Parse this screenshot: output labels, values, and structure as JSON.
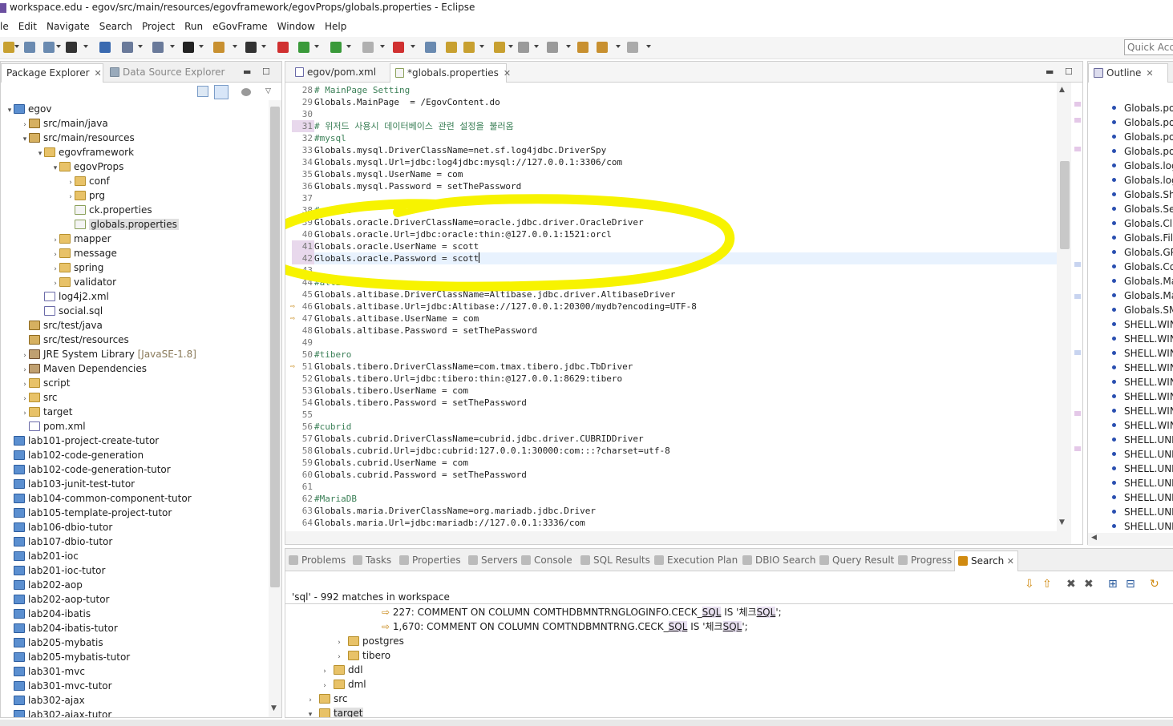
{
  "window": {
    "title": "workspace.edu - egov/src/main/resources/egovframework/egovProps/globals.properties - Eclipse"
  },
  "menu": [
    "le",
    "Edit",
    "Navigate",
    "Search",
    "Project",
    "Run",
    "eGovFrame",
    "Window",
    "Help"
  ],
  "quick_access": "Quick Acce",
  "explorer": {
    "tabs": [
      {
        "label": "Package Explorer",
        "active": true
      },
      {
        "label": "Data Source Explorer",
        "active": false
      }
    ],
    "tree": [
      {
        "depth": 0,
        "label": "egov",
        "toggle": "▾",
        "icon": "proj"
      },
      {
        "depth": 1,
        "label": "src/main/java",
        "toggle": "›",
        "icon": "src"
      },
      {
        "depth": 1,
        "label": "src/main/resources",
        "toggle": "▾",
        "icon": "src"
      },
      {
        "depth": 2,
        "label": "egovframework",
        "toggle": "▾",
        "icon": "folder"
      },
      {
        "depth": 3,
        "label": "egovProps",
        "toggle": "▾",
        "icon": "folder"
      },
      {
        "depth": 4,
        "label": "conf",
        "toggle": "›",
        "icon": "folder"
      },
      {
        "depth": 4,
        "label": "prg",
        "toggle": "›",
        "icon": "folder"
      },
      {
        "depth": 4,
        "label": "ck.properties",
        "toggle": "",
        "icon": "file"
      },
      {
        "depth": 4,
        "label": "globals.properties",
        "toggle": "",
        "icon": "file",
        "selected": true
      },
      {
        "depth": 3,
        "label": "mapper",
        "toggle": "›",
        "icon": "folder"
      },
      {
        "depth": 3,
        "label": "message",
        "toggle": "›",
        "icon": "folder"
      },
      {
        "depth": 3,
        "label": "spring",
        "toggle": "›",
        "icon": "folder"
      },
      {
        "depth": 3,
        "label": "validator",
        "toggle": "›",
        "icon": "folder"
      },
      {
        "depth": 2,
        "label": "log4j2.xml",
        "toggle": "",
        "icon": "xml"
      },
      {
        "depth": 2,
        "label": "social.sql",
        "toggle": "",
        "icon": "xml"
      },
      {
        "depth": 1,
        "label": "src/test/java",
        "toggle": "",
        "icon": "src"
      },
      {
        "depth": 1,
        "label": "src/test/resources",
        "toggle": "",
        "icon": "src"
      },
      {
        "depth": 1,
        "label": "JRE System Library",
        "extra": "[JavaSE-1.8]",
        "toggle": "›",
        "icon": "lib"
      },
      {
        "depth": 1,
        "label": "Maven Dependencies",
        "toggle": "›",
        "icon": "lib"
      },
      {
        "depth": 1,
        "label": "script",
        "toggle": "›",
        "icon": "folder"
      },
      {
        "depth": 1,
        "label": "src",
        "toggle": "›",
        "icon": "folder"
      },
      {
        "depth": 1,
        "label": "target",
        "toggle": "›",
        "icon": "folder"
      },
      {
        "depth": 1,
        "label": "pom.xml",
        "toggle": "",
        "icon": "xml"
      },
      {
        "depth": 0,
        "label": "lab101-project-create-tutor",
        "toggle": "",
        "icon": "proj"
      },
      {
        "depth": 0,
        "label": "lab102-code-generation",
        "toggle": "",
        "icon": "proj"
      },
      {
        "depth": 0,
        "label": "lab102-code-generation-tutor",
        "toggle": "",
        "icon": "proj"
      },
      {
        "depth": 0,
        "label": "lab103-junit-test-tutor",
        "toggle": "",
        "icon": "proj"
      },
      {
        "depth": 0,
        "label": "lab104-common-component-tutor",
        "toggle": "",
        "icon": "proj"
      },
      {
        "depth": 0,
        "label": "lab105-template-project-tutor",
        "toggle": "",
        "icon": "proj"
      },
      {
        "depth": 0,
        "label": "lab106-dbio-tutor",
        "toggle": "",
        "icon": "proj"
      },
      {
        "depth": 0,
        "label": "lab107-dbio-tutor",
        "toggle": "",
        "icon": "proj"
      },
      {
        "depth": 0,
        "label": "lab201-ioc",
        "toggle": "",
        "icon": "proj"
      },
      {
        "depth": 0,
        "label": "lab201-ioc-tutor",
        "toggle": "",
        "icon": "proj"
      },
      {
        "depth": 0,
        "label": "lab202-aop",
        "toggle": "",
        "icon": "proj"
      },
      {
        "depth": 0,
        "label": "lab202-aop-tutor",
        "toggle": "",
        "icon": "proj"
      },
      {
        "depth": 0,
        "label": "lab204-ibatis",
        "toggle": "",
        "icon": "proj"
      },
      {
        "depth": 0,
        "label": "lab204-ibatis-tutor",
        "toggle": "",
        "icon": "proj"
      },
      {
        "depth": 0,
        "label": "lab205-mybatis",
        "toggle": "",
        "icon": "proj"
      },
      {
        "depth": 0,
        "label": "lab205-mybatis-tutor",
        "toggle": "",
        "icon": "proj"
      },
      {
        "depth": 0,
        "label": "lab301-mvc",
        "toggle": "",
        "icon": "proj"
      },
      {
        "depth": 0,
        "label": "lab301-mvc-tutor",
        "toggle": "",
        "icon": "proj"
      },
      {
        "depth": 0,
        "label": "lab302-ajax",
        "toggle": "",
        "icon": "proj"
      },
      {
        "depth": 0,
        "label": "lab302-ajax-tutor",
        "toggle": "",
        "icon": "proj"
      }
    ]
  },
  "editor": {
    "tabs": [
      {
        "label": "egov/pom.xml",
        "active": false
      },
      {
        "label": "*globals.properties",
        "active": true
      }
    ],
    "lines": [
      {
        "n": "28",
        "text": "# MainPage Setting",
        "comment": true
      },
      {
        "n": "29",
        "text": "Globals.MainPage  = /EgovContent.do"
      },
      {
        "n": "30",
        "text": ""
      },
      {
        "n": "31",
        "text": "# 위저드 사용시 데이터베이스 관련 설정을 불러옴",
        "comment": true,
        "mark": true
      },
      {
        "n": "32",
        "text": "#mysql",
        "comment": true
      },
      {
        "n": "33",
        "text": "Globals.mysql.DriverClassName=net.sf.log4jdbc.DriverSpy"
      },
      {
        "n": "34",
        "text": "Globals.mysql.Url=jdbc:log4jdbc:mysql://127.0.0.1:3306/com"
      },
      {
        "n": "35",
        "text": "Globals.mysql.UserName = com"
      },
      {
        "n": "36",
        "text": "Globals.mysql.Password = setThePassword"
      },
      {
        "n": "37",
        "text": ""
      },
      {
        "n": "38",
        "text": "#oracle",
        "comment": true
      },
      {
        "n": "39",
        "text": "Globals.oracle.DriverClassName=oracle.jdbc.driver.OracleDriver"
      },
      {
        "n": "40",
        "text": "Globals.oracle.Url=jdbc:oracle:thin:@127.0.0.1:1521:orcl"
      },
      {
        "n": "41",
        "text": "Globals.oracle.UserName = scott",
        "mark": true
      },
      {
        "n": "42",
        "text": "Globals.oracle.Password = scott",
        "mark": true,
        "current": true
      },
      {
        "n": "43",
        "text": ""
      },
      {
        "n": "44",
        "text": "#altibase",
        "comment": true
      },
      {
        "n": "45",
        "text": "Globals.altibase.DriverClassName=Altibase.jdbc.driver.AltibaseDriver"
      },
      {
        "n": "46",
        "text": "Globals.altibase.Url=jdbc:Altibase://127.0.0.1:20300/mydb?encoding=UTF-8",
        "arrow": true
      },
      {
        "n": "47",
        "text": "Globals.altibase.UserName = com",
        "arrow": true
      },
      {
        "n": "48",
        "text": "Globals.altibase.Password = setThePassword"
      },
      {
        "n": "49",
        "text": ""
      },
      {
        "n": "50",
        "text": "#tibero",
        "comment": true
      },
      {
        "n": "51",
        "text": "Globals.tibero.DriverClassName=com.tmax.tibero.jdbc.TbDriver",
        "arrow": true
      },
      {
        "n": "52",
        "text": "Globals.tibero.Url=jdbc:tibero:thin:@127.0.0.1:8629:tibero"
      },
      {
        "n": "53",
        "text": "Globals.tibero.UserName = com"
      },
      {
        "n": "54",
        "text": "Globals.tibero.Password = setThePassword"
      },
      {
        "n": "55",
        "text": ""
      },
      {
        "n": "56",
        "text": "#cubrid",
        "comment": true
      },
      {
        "n": "57",
        "text": "Globals.cubrid.DriverClassName=cubrid.jdbc.driver.CUBRIDDriver"
      },
      {
        "n": "58",
        "text": "Globals.cubrid.Url=jdbc:cubrid:127.0.0.1:30000:com:::?charset=utf-8"
      },
      {
        "n": "59",
        "text": "Globals.cubrid.UserName = com"
      },
      {
        "n": "60",
        "text": "Globals.cubrid.Password = setThePassword"
      },
      {
        "n": "61",
        "text": ""
      },
      {
        "n": "62",
        "text": "#MariaDB",
        "comment": true
      },
      {
        "n": "63",
        "text": "Globals.maria.DriverClassName=org.mariadb.jdbc.Driver"
      },
      {
        "n": "64",
        "text": "Globals.maria.Url=jdbc:mariadb://127.0.0.1:3336/com"
      }
    ],
    "highlight_color": "#ffff00"
  },
  "outline": {
    "title": "Outline",
    "items": [
      "Globals.pos",
      "Globals.pos",
      "Globals.pos",
      "Globals.pos",
      "Globals.log",
      "Globals.log",
      "Globals.She",
      "Globals.Ser",
      "Globals.Clie",
      "Globals.File",
      "Globals.GPI",
      "Globals.Cor",
      "Globals.Ma",
      "Globals.Ma",
      "Globals.SM",
      "SHELL.WIN",
      "SHELL.WIN",
      "SHELL.WIN",
      "SHELL.WIN",
      "SHELL.WIN",
      "SHELL.WIN",
      "SHELL.WIN",
      "SHELL.WIN",
      "SHELL.UNI",
      "SHELL.UNI",
      "SHELL.UNI",
      "SHELL.UNI",
      "SHELL.UNI",
      "SHELL.UNI",
      "SHELL.UNI"
    ]
  },
  "bottom": {
    "tabs": [
      "Problems",
      "Tasks",
      "Properties",
      "Servers",
      "Console",
      "SQL Results",
      "Execution Plan",
      "DBIO Search",
      "Query Result",
      "Progress",
      "Search"
    ],
    "summary": "'sql' - 992 matches in workspace",
    "results": [
      {
        "indent": 120,
        "prefix": "227: COMMENT ON COLUMN COMTHDBMNTRNGLOGINFO.CECK_",
        "match": "SQL",
        "mid": " IS '체크",
        "match2": "SQL",
        "suffix": "';"
      },
      {
        "indent": 120,
        "prefix": "1,670: COMMENT ON COLUMN COMTNDBMNTRNG.CECK_",
        "match": "SQL",
        "mid": " IS '체크",
        "match2": "SQL",
        "suffix": "';"
      }
    ],
    "tree": [
      {
        "indent": 62,
        "label": "postgres",
        "toggle": "›"
      },
      {
        "indent": 62,
        "label": "tibero",
        "toggle": "›"
      },
      {
        "indent": 44,
        "label": "ddl",
        "toggle": "›"
      },
      {
        "indent": 44,
        "label": "dml",
        "toggle": "›"
      },
      {
        "indent": 26,
        "label": "src",
        "toggle": "›"
      },
      {
        "indent": 26,
        "label": "target",
        "toggle": "▾"
      }
    ]
  }
}
